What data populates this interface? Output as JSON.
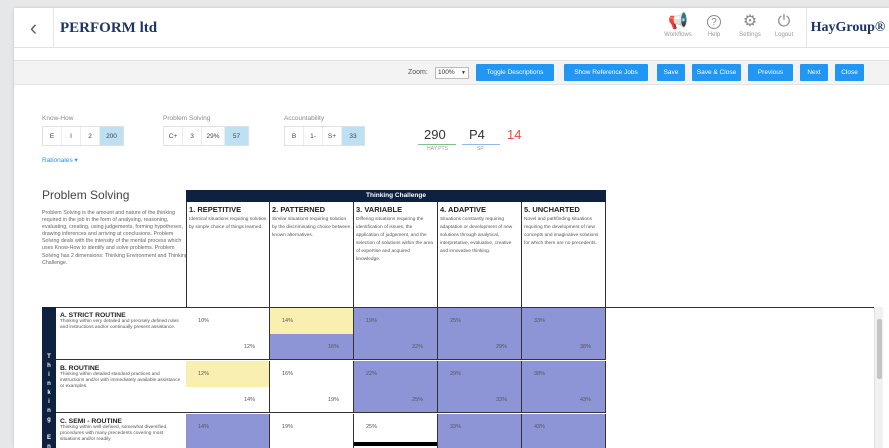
{
  "header": {
    "back_icon": "chevron-left-icon",
    "title": "PERFORM ltd",
    "buttons": [
      {
        "label": "Workflows",
        "icon": "megaphone-icon",
        "glyph": "📢"
      },
      {
        "label": "Help",
        "icon": "help-icon",
        "glyph": "?"
      },
      {
        "label": "Settings",
        "icon": "gear-icon",
        "glyph": "⚙"
      },
      {
        "label": "Logout",
        "icon": "power-icon",
        "glyph": "⏻"
      }
    ],
    "brand": "HayGroup®"
  },
  "toolbar": {
    "zoom_label": "Zoom:",
    "zoom_value": "100%",
    "buttons": [
      "Toggle Descriptions",
      "Show Reference Jobs",
      "Save",
      "Save & Close",
      "Previous",
      "Next",
      "Close"
    ]
  },
  "scores": {
    "know_how": {
      "label": "Know-How",
      "options": [
        "E",
        "I",
        "2",
        "200"
      ],
      "selected": 3
    },
    "problem_solving": {
      "label": "Problem Solving",
      "options": [
        "C+",
        "3",
        "29%",
        "57"
      ],
      "selected": 3
    },
    "accountability": {
      "label": "Accountability",
      "options": [
        "B",
        "1-",
        "S+",
        "33"
      ],
      "selected": 3
    },
    "hay_pts": "290",
    "hay_pts_label": "HAY PTS",
    "grade": "P4",
    "grade_label": "SP",
    "extra": "14"
  },
  "rationales": "Rationales ▾",
  "problem_solving": {
    "title": "Problem Solving",
    "description": "Problem Solving is the amount and nature of the thinking required in the job in the form of analysing, reasoning, evaluating, creating, using judgements, forming hypotheses, drawing inferences and arriving at conclusions. Problem Solving deals with the intensity of the mental process which uses Know-How to identify and solve problems. Problem Solving has 2 dimensions: Thinking Environment and Thinking Challenge."
  },
  "matrix": {
    "header": "Thinking Challenge",
    "side_label": "Thinking En",
    "columns": [
      {
        "title": "1. REPETITIVE",
        "desc": "Identical situations requiring solution by simple choice of things learned."
      },
      {
        "title": "2. PATTERNED",
        "desc": "Similar situations requiring solution by the discriminating choice between known alternatives."
      },
      {
        "title": "3. VARIABLE",
        "desc": "Differing situations requiring the identification of issues, the application of judgement, and the selection of solutions within the area of expertise and acquired knowledge."
      },
      {
        "title": "4. ADAPTIVE",
        "desc": "Situations constantly requiring adaptation or development of new solutions through analytical, interpretative, evaluative, creative and innovative thinking."
      },
      {
        "title": "5. UNCHARTED",
        "desc": "Novel and pathfinding situations requiring the development of new concepts and imaginative solutions for which there are no precedents."
      }
    ],
    "rows": [
      {
        "title": "A. STRICT ROUTINE",
        "desc": "Thinking within very detailed and precisely defined rules and instructions and/or continually present assistance.",
        "cells": [
          [
            "10%",
            "12%"
          ],
          [
            "14%",
            "16%"
          ],
          [
            "19%",
            "22%"
          ],
          [
            "25%",
            "29%"
          ],
          [
            "33%",
            "38%"
          ]
        ]
      },
      {
        "title": "B. ROUTINE",
        "desc": "Thinking within detailed standard practices and instructions and/or with immediately available assistance or examples.",
        "cells": [
          [
            "12%",
            "14%"
          ],
          [
            "16%",
            "19%"
          ],
          [
            "22%",
            "25%"
          ],
          [
            "29%",
            "33%"
          ],
          [
            "38%",
            "43%"
          ]
        ]
      },
      {
        "title": "C. SEMI - ROUTINE",
        "desc": "Thinking within well-defined, somewhat diversified, procedures with many precedents covering most situations and/or readily",
        "cells": [
          [
            "14%",
            ""
          ],
          [
            "19%",
            ""
          ],
          [
            "25%",
            ""
          ],
          [
            "33%",
            ""
          ],
          [
            "43%",
            ""
          ]
        ]
      }
    ]
  },
  "colors": {
    "accent": "#2196f3",
    "navy": "#0e2141",
    "cell_purple": "#8d95d6",
    "cell_yellow": "#f8efb0",
    "selected_segment": "#bde0f2",
    "red": "#e74c3c"
  }
}
